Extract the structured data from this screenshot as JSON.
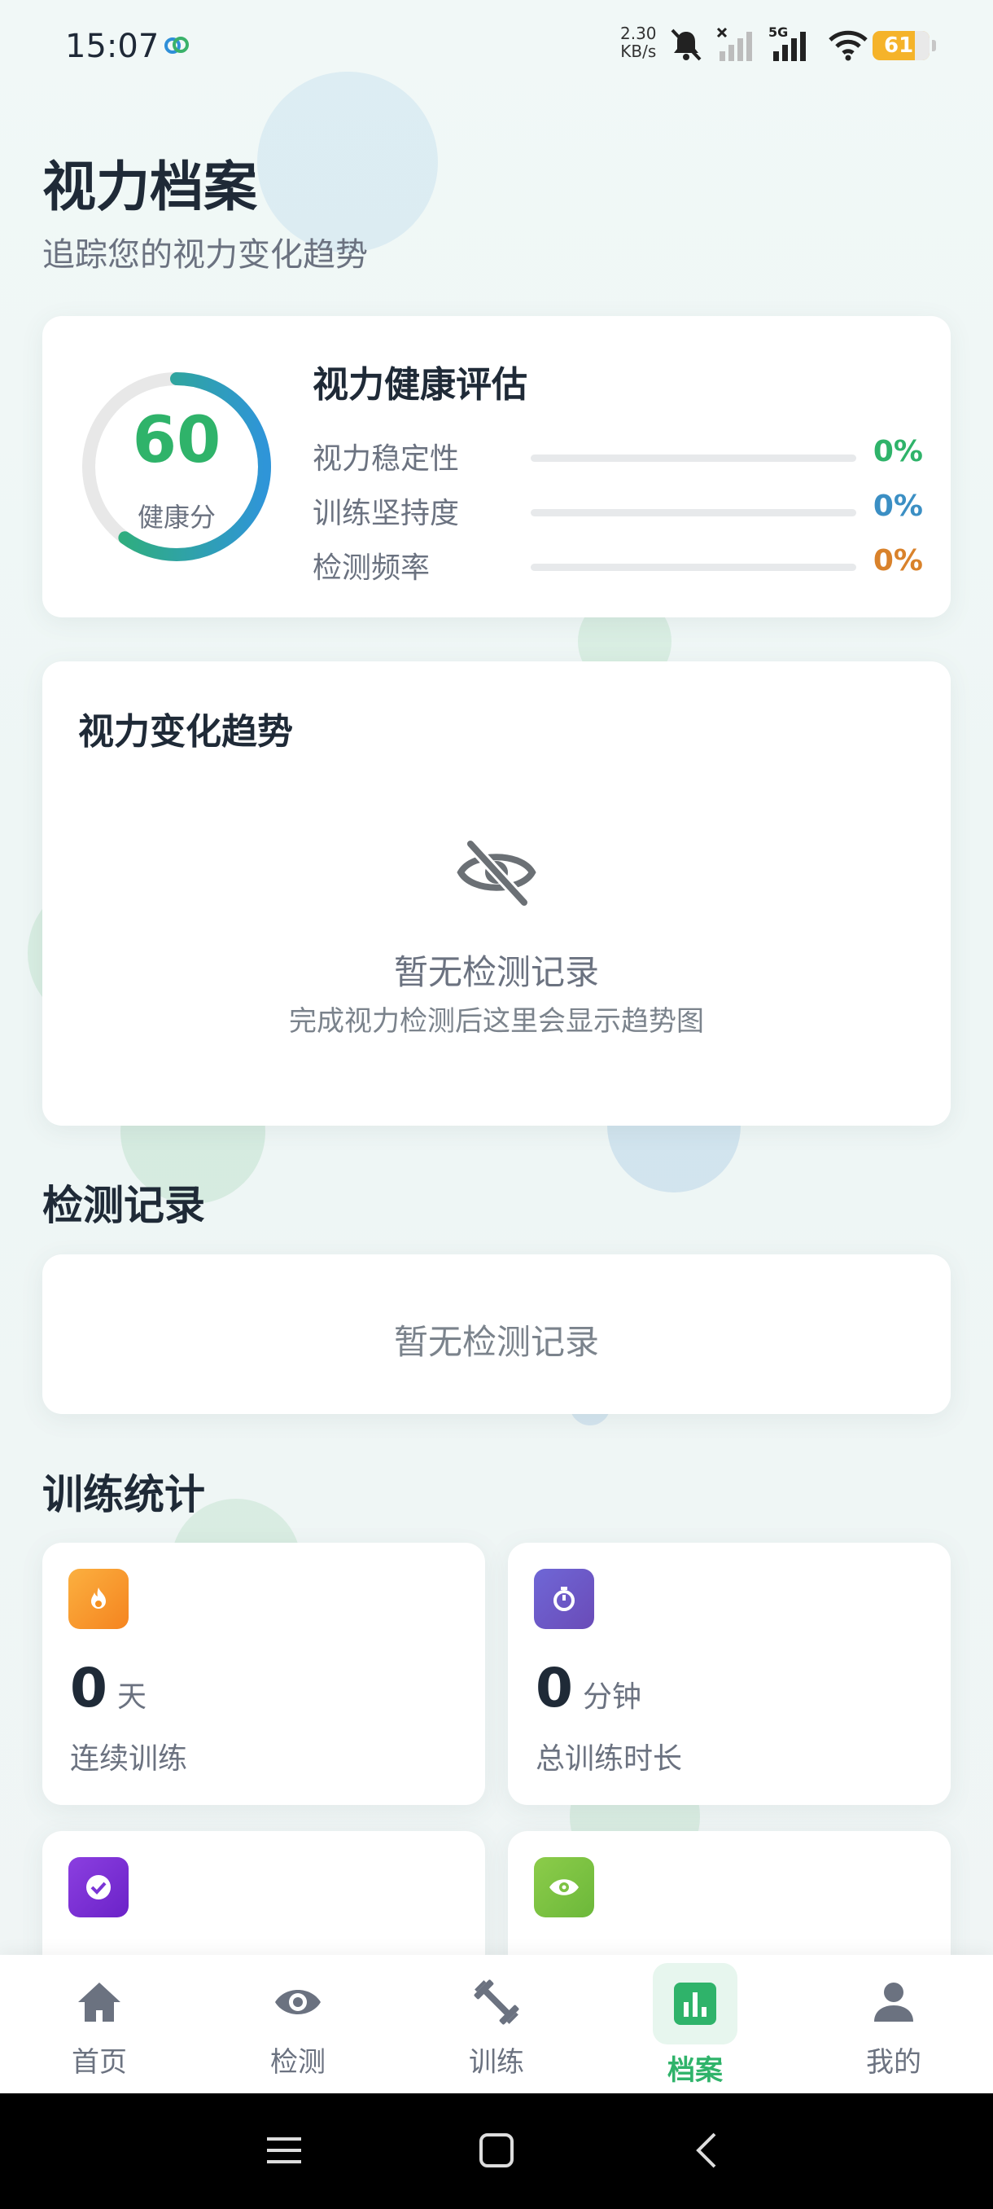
{
  "status_bar": {
    "time": "15:07",
    "net_speed_value": "2.30",
    "net_speed_unit": "KB/s",
    "network": "5G",
    "battery": "61",
    "icons": [
      "cloud-icon",
      "mute-bell-icon",
      "no-signal-icon",
      "signal-5g-icon",
      "wifi-icon",
      "battery-icon"
    ]
  },
  "header": {
    "title": "视力档案",
    "subtitle": "追踪您的视力变化趋势"
  },
  "health": {
    "score": "60",
    "score_label": "健康分",
    "score_fraction": 0.6,
    "title": "视力健康评估",
    "metrics": [
      {
        "label": "视力稳定性",
        "value": "0%",
        "fraction": 0,
        "color": "#2fb36a"
      },
      {
        "label": "训练坚持度",
        "value": "0%",
        "fraction": 0,
        "color": "#3b8fc4"
      },
      {
        "label": "检测频率",
        "value": "0%",
        "fraction": 0,
        "color": "#d9822b"
      }
    ]
  },
  "trend": {
    "title": "视力变化趋势",
    "empty_title": "暂无检测记录",
    "empty_sub": "完成视力检测后这里会显示趋势图",
    "icon": "eye-off-icon"
  },
  "records": {
    "title": "检测记录",
    "empty": "暂无检测记录"
  },
  "training": {
    "title": "训练统计",
    "stats": [
      {
        "value": "0",
        "unit": "天",
        "label": "连续训练",
        "icon": "fire-icon",
        "color": "#f59a1e"
      },
      {
        "value": "0",
        "unit": "分钟",
        "label": "总训练时长",
        "icon": "timer-icon",
        "color": "#6d5bd0"
      },
      {
        "value": "",
        "unit": "",
        "label": "",
        "icon": "check-circle-icon",
        "color": "#7a34d6"
      },
      {
        "value": "",
        "unit": "",
        "label": "",
        "icon": "eye-icon",
        "color": "#7cc242"
      }
    ]
  },
  "nav": {
    "items": [
      {
        "label": "首页",
        "icon": "home-icon"
      },
      {
        "label": "检测",
        "icon": "eye-icon"
      },
      {
        "label": "训练",
        "icon": "dumbbell-icon"
      },
      {
        "label": "档案",
        "icon": "chart-icon",
        "active": true
      },
      {
        "label": "我的",
        "icon": "person-icon"
      }
    ]
  },
  "colors": {
    "accent": "#2fb36a",
    "text": "#1f2a37",
    "muted": "#6b7280"
  }
}
